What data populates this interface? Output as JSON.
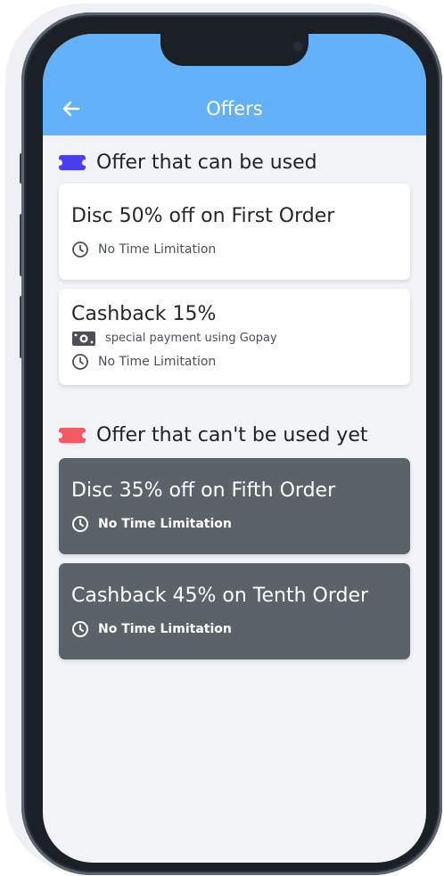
{
  "header": {
    "title": "Offers",
    "background_color": "#63b1f8",
    "back_icon": "arrow-left-icon"
  },
  "sections": [
    {
      "heading": "Offer that can be used",
      "icon": "ticket-icon",
      "icon_color": "#4a3ff0",
      "cards": [
        {
          "title": "Disc 50% off on First Order",
          "time_label": "No Time Limitation"
        },
        {
          "title": "Cashback 15%",
          "payment_label": "special payment using Gopay",
          "time_label": "No Time Limitation"
        }
      ]
    },
    {
      "heading": "Offer that can't be used yet",
      "icon": "ticket-icon",
      "icon_color": "#f45a5f",
      "cards": [
        {
          "title": "Disc 35% off on Fifth Order",
          "time_label": "No Time Limitation"
        },
        {
          "title": "Cashback 45% on Tenth Order",
          "time_label": "No Time Limitation"
        }
      ]
    }
  ],
  "colors": {
    "locked_card": "#5b6369",
    "screen_background": "#f1f3f7"
  }
}
